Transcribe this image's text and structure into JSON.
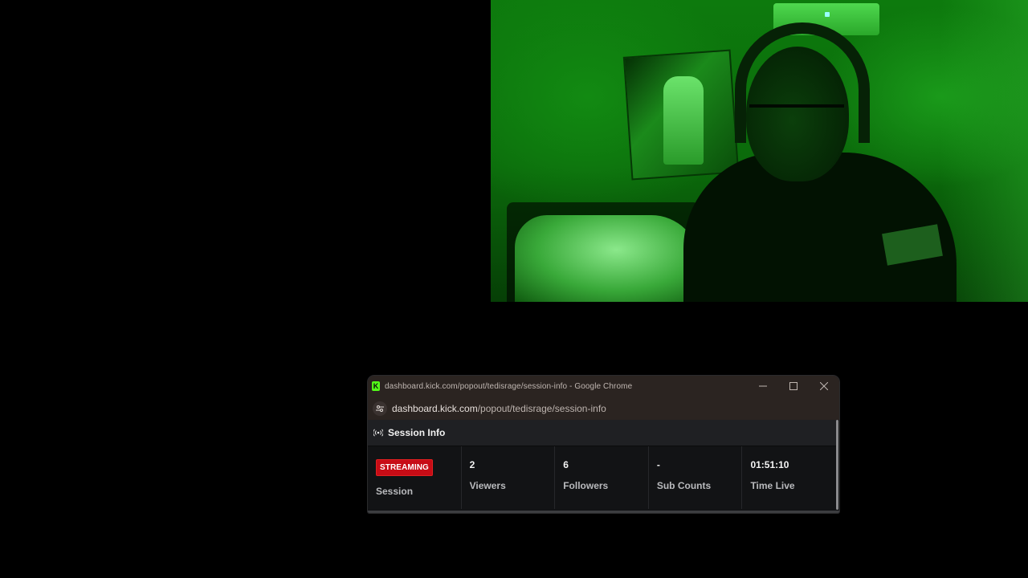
{
  "window": {
    "title": "dashboard.kick.com/popout/tedisrage/session-info - Google Chrome",
    "favicon_letter": "K",
    "minimize_glyph": "—",
    "maximize_glyph": "☐",
    "close_glyph": "✕"
  },
  "address_bar": {
    "url_host": "dashboard.kick.com",
    "url_path": "/popout/tedisrage/session-info"
  },
  "panel": {
    "title": "Session Info"
  },
  "stats": [
    {
      "value": "STREAMING",
      "label": "Session"
    },
    {
      "value": "2",
      "label": "Viewers"
    },
    {
      "value": "6",
      "label": "Followers"
    },
    {
      "value": "-",
      "label": "Sub Counts"
    },
    {
      "value": "01:51:10",
      "label": "Time Live"
    }
  ],
  "colors": {
    "kick_green": "#53fc18",
    "streaming_badge": "#c70c16"
  }
}
